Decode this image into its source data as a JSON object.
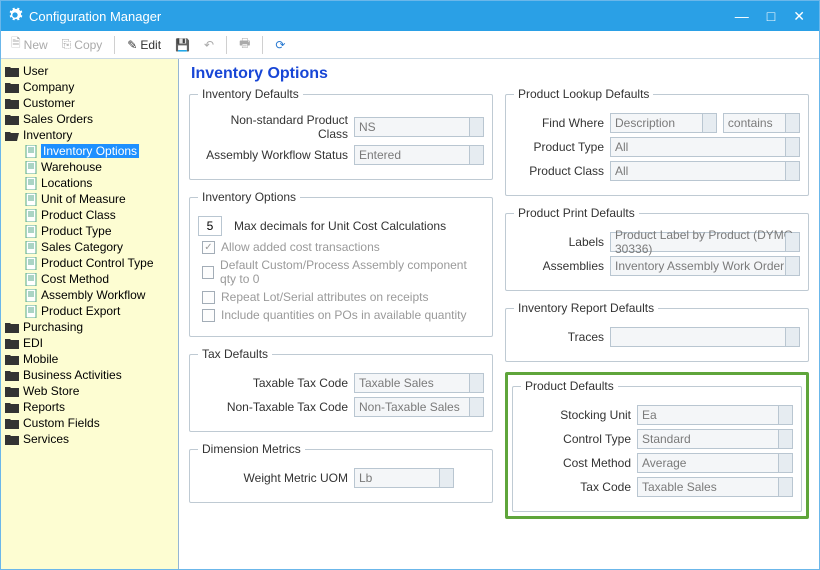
{
  "window": {
    "title": "Configuration Manager"
  },
  "toolbar": {
    "new": "New",
    "copy": "Copy",
    "edit": "Edit"
  },
  "nav": {
    "user": "User",
    "company": "Company",
    "customer": "Customer",
    "sales_orders": "Sales Orders",
    "inventory": "Inventory",
    "inv": {
      "options": "Inventory Options",
      "warehouse": "Warehouse",
      "locations": "Locations",
      "uom": "Unit of Measure",
      "prod_class": "Product Class",
      "prod_type": "Product Type",
      "sales_cat": "Sales Category",
      "ctrl_type": "Product Control Type",
      "cost_method": "Cost Method",
      "assembly": "Assembly Workflow",
      "export": "Product Export"
    },
    "purchasing": "Purchasing",
    "edi": "EDI",
    "mobile": "Mobile",
    "bus_act": "Business Activities",
    "web_store": "Web Store",
    "reports": "Reports",
    "custom_fields": "Custom Fields",
    "services": "Services"
  },
  "page": {
    "title": "Inventory Options"
  },
  "inv_defaults": {
    "legend": "Inventory Defaults",
    "nonstd_label": "Non-standard Product Class",
    "nonstd_value": "NS",
    "assembly_label": "Assembly Workflow Status",
    "assembly_value": "Entered"
  },
  "inv_options": {
    "legend": "Inventory Options",
    "max_decimals": "5",
    "max_decimals_label": "Max decimals for Unit Cost Calculations",
    "allow_added": "Allow added cost transactions",
    "default_qty0": "Default Custom/Process Assembly component qty to 0",
    "repeat_lot": "Repeat Lot/Serial attributes on receipts",
    "include_po": "Include quantities on POs in available quantity"
  },
  "tax_defaults": {
    "legend": "Tax Defaults",
    "taxable_label": "Taxable Tax Code",
    "taxable_value": "Taxable Sales",
    "nontax_label": "Non-Taxable Tax Code",
    "nontax_value": "Non-Taxable Sales"
  },
  "dim_metrics": {
    "legend": "Dimension Metrics",
    "weight_label": "Weight Metric UOM",
    "weight_value": "Lb"
  },
  "lookup": {
    "legend": "Product Lookup Defaults",
    "find_label": "Find Where",
    "find_value": "Description",
    "find_op": "contains",
    "type_label": "Product Type",
    "type_value": "All",
    "class_label": "Product Class",
    "class_value": "All"
  },
  "print": {
    "legend": "Product Print Defaults",
    "labels_label": "Labels",
    "labels_value": "Product Label by Product (DYMO 30336)",
    "asm_label": "Assemblies",
    "asm_value": "Inventory Assembly Work Order"
  },
  "report": {
    "legend": "Inventory Report Defaults",
    "traces_label": "Traces",
    "traces_value": ""
  },
  "prod_defaults": {
    "legend": "Product Defaults",
    "stock_label": "Stocking Unit",
    "stock_value": "Ea",
    "ctrl_label": "Control Type",
    "ctrl_value": "Standard",
    "cost_label": "Cost Method",
    "cost_value": "Average",
    "tax_label": "Tax Code",
    "tax_value": "Taxable Sales"
  }
}
